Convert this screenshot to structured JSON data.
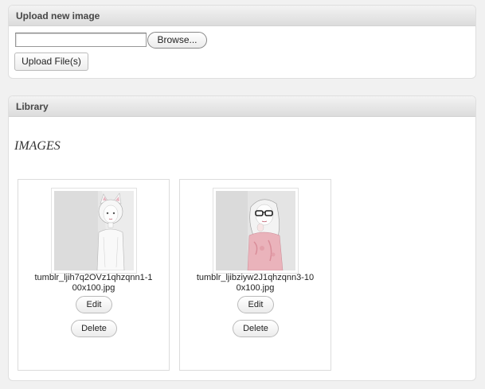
{
  "upload": {
    "title": "Upload new image",
    "browse_label": "Browse...",
    "upload_label": "Upload File(s)"
  },
  "library": {
    "title": "Library",
    "section_heading": "IMAGES",
    "items": [
      {
        "filename_line1": "tumblr_ljih7q2OVz1qhzqnn1-1",
        "filename_line2": "00x100.jpg",
        "edit_label": "Edit",
        "delete_label": "Delete",
        "thumbnail": "sketch-girl-cat-ears"
      },
      {
        "filename_line1": "tumblr_ljibziyw2J1qhzqnn3-10",
        "filename_line2": "0x100.jpg",
        "edit_label": "Edit",
        "delete_label": "Delete",
        "thumbnail": "sketch-girl-glasses-pink"
      }
    ]
  },
  "colors": {
    "page_bg": "#f1f1f1",
    "header_text": "#464646",
    "border": "#dfdfdf"
  }
}
